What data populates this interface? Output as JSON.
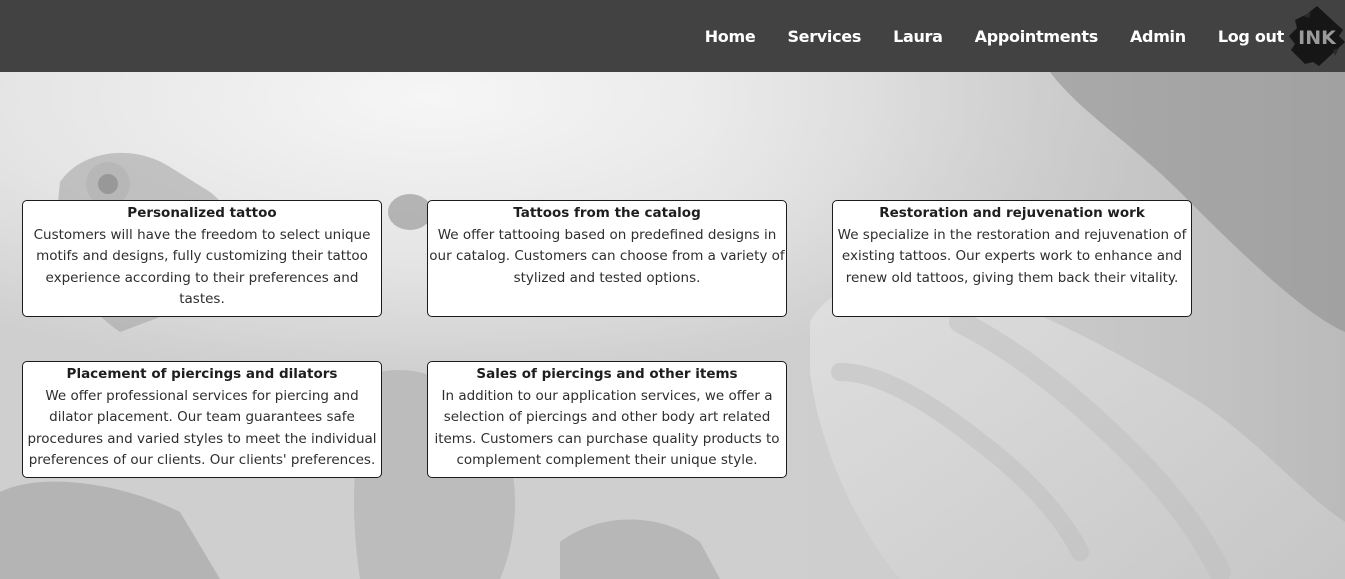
{
  "nav": {
    "links": [
      "Home",
      "Services",
      "Laura",
      "Appointments",
      "Admin",
      "Log out"
    ],
    "logo_text": "INK"
  },
  "cards": [
    {
      "title": "Personalized tattoo",
      "text": "Customers will have the freedom to select unique motifs and designs, fully customizing their tattoo experience according to their preferences and tastes."
    },
    {
      "title": "Tattoos from the catalog",
      "text": "We offer tattooing based on predefined designs in our catalog. Customers can choose from a variety of stylized and tested options."
    },
    {
      "title": "Restoration and rejuvenation work",
      "text": "We specialize in the restoration and rejuvenation of existing tattoos. Our experts work to enhance and renew old tattoos, giving them back their vitality."
    },
    {
      "title": "Placement of piercings and dilators",
      "text": "We offer professional services for piercing and dilator placement. Our team guarantees safe procedures and varied styles to meet the individual preferences of our clients. Our clients' preferences."
    },
    {
      "title": "Sales of piercings and other items",
      "text": "In addition to our application services, we offer a selection of piercings and other body art related items. Customers can purchase quality products to complement complement their unique style."
    }
  ],
  "colors": {
    "navbar": "#424242",
    "nav_text": "#ffffff",
    "card_bg": "#ffffff",
    "card_border": "#1c1c1c"
  }
}
